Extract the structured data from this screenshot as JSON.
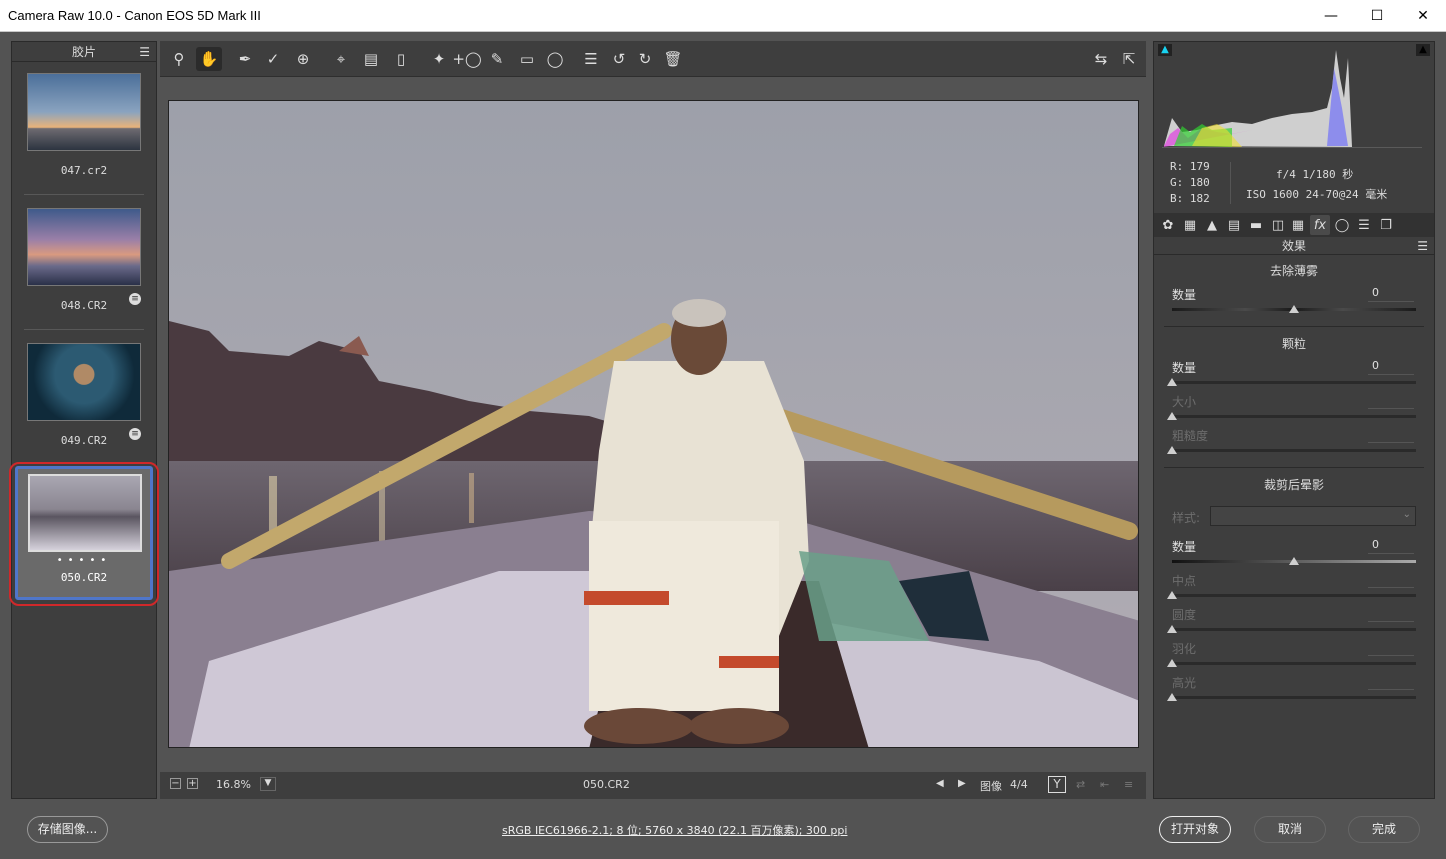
{
  "window": {
    "title": "Camera Raw 10.0 -  Canon EOS 5D Mark III"
  },
  "filmstrip": {
    "header": "胶片",
    "items": [
      {
        "label": "047.cr2"
      },
      {
        "label": "048.CR2"
      },
      {
        "label": "049.CR2"
      },
      {
        "label": "050.CR2",
        "selected": true
      }
    ]
  },
  "toolbar": {
    "tools": [
      "zoom-icon",
      "hand-icon",
      "white-balance-icon",
      "color-sampler-icon",
      "target-adjust-icon",
      "crop-icon",
      "straighten-icon",
      "transform-icon",
      "spot-removal-icon",
      "red-eye-icon",
      "adjustment-brush-icon",
      "graduated-filter-icon",
      "radial-filter-icon",
      "preferences-icon",
      "rotate-ccw-icon",
      "rotate-cw-icon",
      "trash-icon"
    ]
  },
  "status": {
    "zoom": "16.8%",
    "filename": "050.CR2",
    "image_label": "图像",
    "image_counter": "4/4",
    "y_button": "Y"
  },
  "readout": {
    "r": "R:  179",
    "g": "G:  180",
    "b": "B:  182",
    "exif1": "f/4   1/180 秒",
    "exif2": "ISO 1600   24-70@24 毫米"
  },
  "panel": {
    "title": "效果",
    "dehaze_title": "去除薄雾",
    "grain_title": "颗粒",
    "vignette_title": "裁剪后晕影",
    "style_label": "样式:",
    "sliders": {
      "dehaze_amount": {
        "label": "数量",
        "value": "0",
        "level": 0.5
      },
      "grain_amount": {
        "label": "数量",
        "value": "0",
        "level": 0
      },
      "grain_size": {
        "label": "大小",
        "value": "",
        "level": 0
      },
      "grain_roughness": {
        "label": "粗糙度",
        "value": "",
        "level": 0
      },
      "vig_amount": {
        "label": "数量",
        "value": "0",
        "level": 0.5
      },
      "vig_midpoint": {
        "label": "中点",
        "value": "",
        "level": 0
      },
      "vig_roundness": {
        "label": "圆度",
        "value": "",
        "level": 0
      },
      "vig_feather": {
        "label": "羽化",
        "value": "",
        "level": 0
      },
      "vig_highlights": {
        "label": "高光",
        "value": "",
        "level": 0
      }
    }
  },
  "bottom": {
    "save_label": "存储图像...",
    "info_text": "sRGB IEC61966-2.1; 8 位; 5760 x 3840 (22.1 百万像素); 300 ppi",
    "open_label": "打开对象",
    "cancel_label": "取消",
    "done_label": "完成"
  },
  "colors": {
    "selection_ring": "#d0282a",
    "selected_frame": "#4f76c9",
    "panel_bg": "#3e3e3e"
  }
}
